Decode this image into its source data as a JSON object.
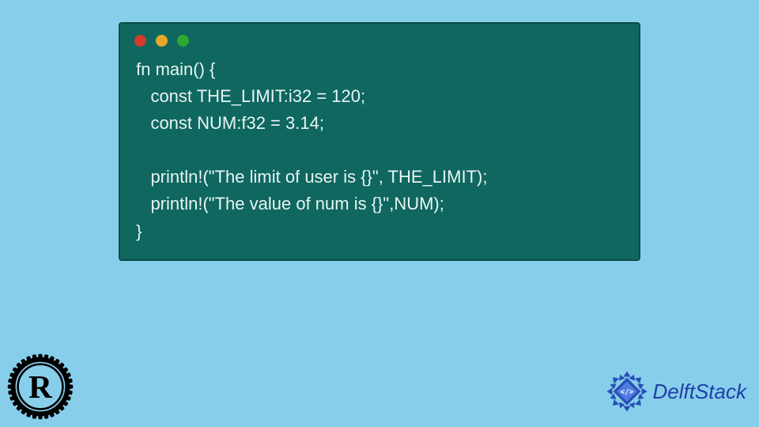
{
  "code": {
    "lines": [
      " fn main() {",
      "    const THE_LIMIT:i32 = 120;",
      "    const NUM:f32 = 3.14;",
      "",
      "    println!(\"The limit of user is {}\", THE_LIMIT);",
      "    println!(\"The value of num is {}\",NUM);",
      " }"
    ]
  },
  "branding": {
    "delft_text": "DelftStack"
  },
  "colors": {
    "bg": "#87ceeb",
    "window": "#0f675f",
    "code_text": "#e8f5f3",
    "delft_blue": "#1d3fa8"
  }
}
